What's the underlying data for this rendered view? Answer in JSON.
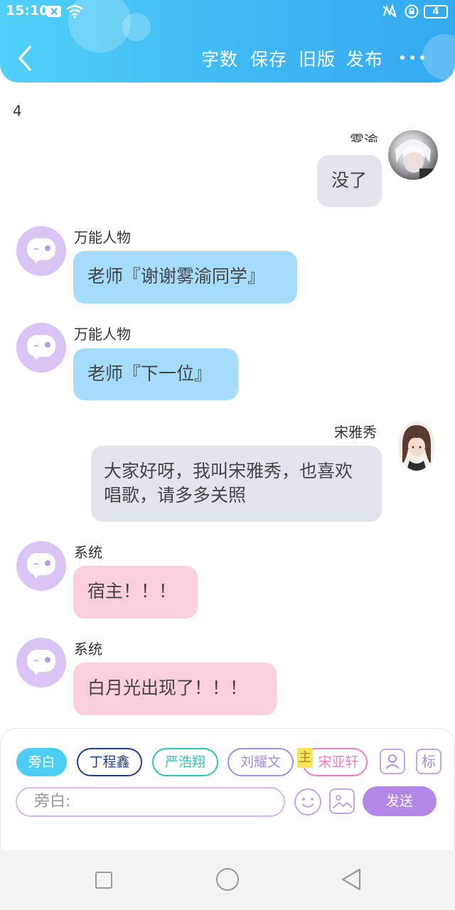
{
  "status_bar": {
    "time": "15:10",
    "battery": "4",
    "icons": [
      "notification-x-icon",
      "wifi-icon",
      "mute-icon",
      "lock-rotation-icon",
      "battery-icon"
    ]
  },
  "header": {
    "back_icon": "chevron-left-icon",
    "buttons": [
      "字数",
      "保存",
      "旧版",
      "发布"
    ],
    "more_icon": "more-dots-icon"
  },
  "word_count": "4",
  "messages": [
    {
      "side": "right",
      "name": "雾渝",
      "text": "没了",
      "style": "gray",
      "avatar": "photo-white-hair"
    },
    {
      "side": "left",
      "name": "万能人物",
      "text": "老师『谢谢雾渝同学』",
      "style": "blue",
      "avatar": "chat-bubble-icon"
    },
    {
      "side": "left",
      "name": "万能人物",
      "text": "老师『下一位』",
      "style": "blue",
      "avatar": "chat-bubble-icon"
    },
    {
      "side": "right",
      "name": "宋雅秀",
      "text": "大家好呀，我叫宋雅秀，也喜欢唱歌，请多多关照",
      "style": "gray",
      "avatar": "photo-brown-hair"
    },
    {
      "side": "left",
      "name": "系统",
      "text": "宿主！！！",
      "style": "pink",
      "avatar": "chat-bubble-icon"
    },
    {
      "side": "left",
      "name": "系统",
      "text": "白月光出现了！！！",
      "style": "pink",
      "avatar": "chat-bubble-icon"
    }
  ],
  "characters": [
    {
      "label": "旁白",
      "color": "#4ccdf3",
      "selected": true
    },
    {
      "label": "丁程鑫",
      "color": "#1f3f8c",
      "selected": false
    },
    {
      "label": "严浩翔",
      "color": "#2fc3b4",
      "selected": false
    },
    {
      "label": "刘耀文",
      "color": "#a98be0",
      "selected": false
    },
    {
      "label": "宋亚轩",
      "color": "#f07cc8",
      "selected": false
    }
  ],
  "main_badge": "主",
  "toolbar": {
    "role_icon": "person-card-icon",
    "tag_label": "标",
    "input_placeholder": "旁白:",
    "emoji_icon": "smile-face-icon",
    "image_icon": "image-icon",
    "send_label": "发送"
  },
  "colors": {
    "header_gradient": [
      "#4fd0f7",
      "#34a9f0"
    ],
    "accent_purple": "#b387e6",
    "bubble_blue": "#a6dcfb",
    "bubble_gray": "#e1e6ee",
    "bubble_pink": "#fbd0dc"
  }
}
